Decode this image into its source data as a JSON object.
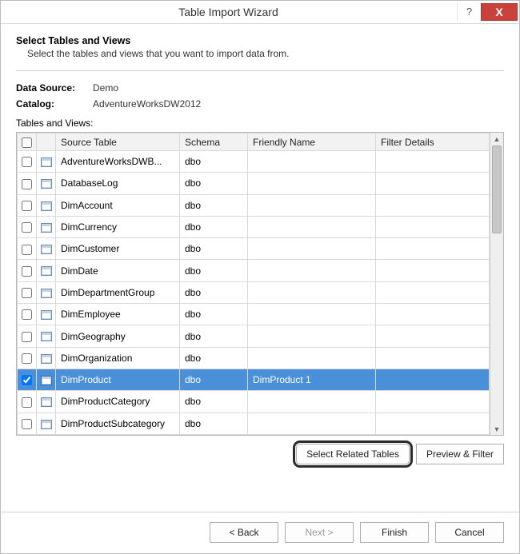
{
  "window": {
    "title": "Table Import Wizard",
    "help_symbol": "?",
    "close_symbol": "X"
  },
  "header": {
    "title": "Select Tables and Views",
    "subtitle": "Select the tables and views that you want to import data from."
  },
  "meta": {
    "data_source_label": "Data Source:",
    "data_source_value": "Demo",
    "catalog_label": "Catalog:",
    "catalog_value": "AdventureWorksDW2012",
    "tables_views_label": "Tables and Views:"
  },
  "grid": {
    "columns": {
      "source_table": "Source Table",
      "schema": "Schema",
      "friendly_name": "Friendly Name",
      "filter_details": "Filter Details"
    },
    "rows": [
      {
        "checked": false,
        "source": "AdventureWorksDWB...",
        "schema": "dbo",
        "friendly": "",
        "filter": "",
        "selected": false
      },
      {
        "checked": false,
        "source": "DatabaseLog",
        "schema": "dbo",
        "friendly": "",
        "filter": "",
        "selected": false
      },
      {
        "checked": false,
        "source": "DimAccount",
        "schema": "dbo",
        "friendly": "",
        "filter": "",
        "selected": false
      },
      {
        "checked": false,
        "source": "DimCurrency",
        "schema": "dbo",
        "friendly": "",
        "filter": "",
        "selected": false
      },
      {
        "checked": false,
        "source": "DimCustomer",
        "schema": "dbo",
        "friendly": "",
        "filter": "",
        "selected": false
      },
      {
        "checked": false,
        "source": "DimDate",
        "schema": "dbo",
        "friendly": "",
        "filter": "",
        "selected": false
      },
      {
        "checked": false,
        "source": "DimDepartmentGroup",
        "schema": "dbo",
        "friendly": "",
        "filter": "",
        "selected": false
      },
      {
        "checked": false,
        "source": "DimEmployee",
        "schema": "dbo",
        "friendly": "",
        "filter": "",
        "selected": false
      },
      {
        "checked": false,
        "source": "DimGeography",
        "schema": "dbo",
        "friendly": "",
        "filter": "",
        "selected": false
      },
      {
        "checked": false,
        "source": "DimOrganization",
        "schema": "dbo",
        "friendly": "",
        "filter": "",
        "selected": false
      },
      {
        "checked": true,
        "source": "DimProduct",
        "schema": "dbo",
        "friendly": "DimProduct 1",
        "filter": "",
        "selected": true
      },
      {
        "checked": false,
        "source": "DimProductCategory",
        "schema": "dbo",
        "friendly": "",
        "filter": "",
        "selected": false
      },
      {
        "checked": false,
        "source": "DimProductSubcategory",
        "schema": "dbo",
        "friendly": "",
        "filter": "",
        "selected": false
      }
    ]
  },
  "buttons": {
    "select_related": "Select Related Tables",
    "preview_filter": "Preview & Filter",
    "back": "< Back",
    "next": "Next >",
    "finish": "Finish",
    "cancel": "Cancel"
  }
}
